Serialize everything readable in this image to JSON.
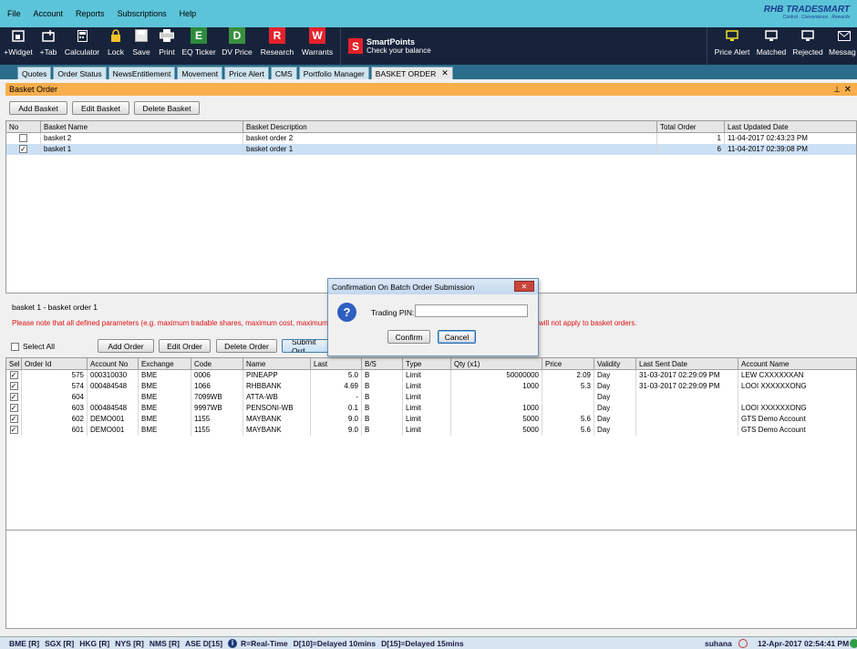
{
  "menu": [
    "File",
    "Account",
    "Reports",
    "Subscriptions",
    "Help"
  ],
  "logo": {
    "brand": "RHB TRADESMART",
    "tagline": "Control . Convenience . Rewards"
  },
  "toolbar": {
    "items": [
      "+Widget",
      "+Tab",
      "Calculator",
      "Lock",
      "Save",
      "Print",
      "EQ Ticker",
      "DV Price",
      "Research",
      "Warrants"
    ],
    "smartpoints_title": "SmartPoints",
    "smartpoints_sub": "Check your balance",
    "right_items": [
      "Price Alert",
      "Matched",
      "Rejected",
      "Messag"
    ]
  },
  "tabs": [
    "Quotes",
    "Order Status",
    "NewsEntitlement",
    "Movement",
    "Price Alert",
    "CMS",
    "Portfolio Manager",
    "BASKET ORDER"
  ],
  "panel": {
    "title": "Basket Order"
  },
  "basket_buttons": {
    "add": "Add Basket",
    "edit": "Edit Basket",
    "delete": "Delete Basket"
  },
  "basket_table": {
    "headers": [
      "No",
      "Basket Name",
      "Basket Description",
      "Total Order",
      "Last Updated Date"
    ],
    "rows": [
      {
        "checked": false,
        "name": "basket 2",
        "description": "basket order 2",
        "total": "1",
        "updated": "11-04-2017 02:43:23 PM"
      },
      {
        "checked": true,
        "name": "basket 1",
        "description": "basket order 1",
        "total": "6",
        "updated": "11-04-2017 02:39:08 PM"
      }
    ]
  },
  "selected_basket": "basket 1 - basket order 1",
  "warning_left": "Please note that all defined parameters (e.g. maximum tradable shares, maximum cost, maximum",
  "warning_right": "will not apply to basket orders.",
  "order_controls": {
    "select_all": "Select All",
    "add": "Add Order",
    "edit": "Edit Order",
    "delete": "Delete Order",
    "submit": "Submit Ord"
  },
  "order_table": {
    "headers": [
      "Sel",
      "Order Id",
      "Account No",
      "Exchange",
      "Code",
      "Name",
      "Last",
      "B/S",
      "Type",
      "Qty (x1)",
      "Price",
      "Validity",
      "Last Sent Date",
      "Account Name"
    ],
    "rows": [
      [
        "575",
        "000310030",
        "BME",
        "0006",
        "PINEAPP",
        "5.0",
        "B",
        "Limit",
        "50000000",
        "2.09",
        "Day",
        "31-03-2017 02:29:09 PM",
        "LEW CXXXXXXAN"
      ],
      [
        "574",
        "000484548",
        "BME",
        "1066",
        "RHBBANK",
        "4.69",
        "B",
        "Limit",
        "1000",
        "5.3",
        "Day",
        "31-03-2017 02:29:09 PM",
        "LOOI XXXXXXONG"
      ],
      [
        "604",
        "",
        "BME",
        "7099WB",
        "ATTA-WB",
        "-",
        "B",
        "Limit",
        "",
        "",
        "Day",
        "",
        ""
      ],
      [
        "603",
        "000484548",
        "BME",
        "9997WB",
        "PENSONI-WB",
        "0.1",
        "B",
        "Limit",
        "1000",
        "",
        "Day",
        "",
        "LOOI XXXXXXONG"
      ],
      [
        "602",
        "DEMO001",
        "BME",
        "1155",
        "MAYBANK",
        "9.0",
        "B",
        "Limit",
        "5000",
        "5.6",
        "Day",
        "",
        "GTS Demo Account"
      ],
      [
        "601",
        "DEMO001",
        "BME",
        "1155",
        "MAYBANK",
        "9.0",
        "B",
        "Limit",
        "5000",
        "5.6",
        "Day",
        "",
        "GTS Demo Account"
      ]
    ]
  },
  "dialog": {
    "title": "Confirmation On Batch Order Submission",
    "pin_label": "Trading PIN:",
    "pin_value": "",
    "confirm": "Confirm",
    "cancel": "Cancel"
  },
  "status": {
    "markets": [
      "BME [R]",
      "SGX [R]",
      "HKG [R]",
      "NYS [R]",
      "NMS [R]",
      "ASE D[15]"
    ],
    "legend": [
      "R=Real-Time",
      "D[10]=Delayed 10mins",
      "D[15]=Delayed 15mins"
    ],
    "user": "suhana",
    "datetime": "12-Apr-2017 02:54:41 PM"
  }
}
